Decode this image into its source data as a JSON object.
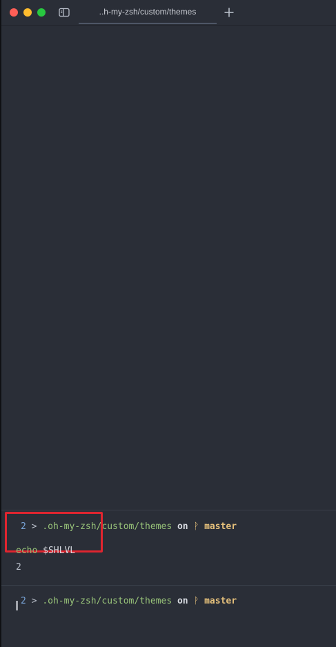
{
  "window": {
    "tab_title": "..h-my-zsh/custom/themes"
  },
  "icons": {
    "sidebar": "sidebar-toggle-icon",
    "new_tab": "plus-icon",
    "branch": "git-branch-icon"
  },
  "colors": {
    "background": "#2a2e37",
    "path": "#98c379",
    "branch": "#e5c07b",
    "level": "#7aa6da",
    "highlight": "#e1252f"
  },
  "terminal": {
    "prompts": [
      {
        "level": "2",
        "separator": ">",
        "path": ".oh-my-zsh/custom/themes",
        "on": "on",
        "branch_symbol": "ᚹ",
        "branch": "master"
      },
      {
        "level": "2",
        "separator": ">",
        "path": ".oh-my-zsh/custom/themes",
        "on": "on",
        "branch_symbol": "ᚹ",
        "branch": "master"
      }
    ],
    "command": {
      "name": "echo",
      "argument": "$SHLVL"
    },
    "output": "2"
  }
}
